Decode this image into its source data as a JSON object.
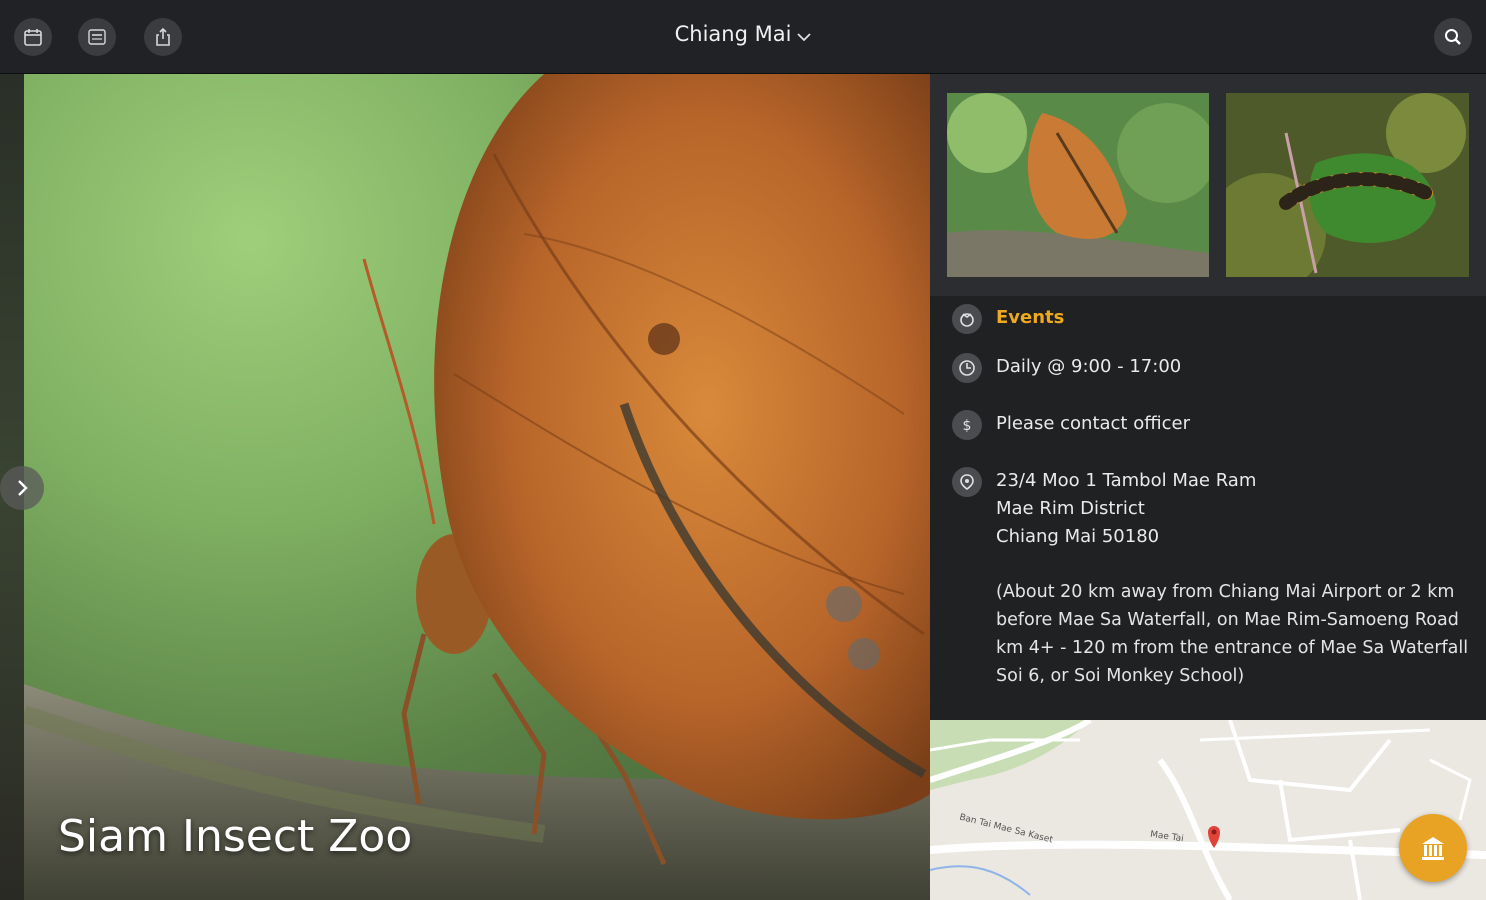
{
  "header": {
    "city": "Chiang Mai",
    "icons": [
      "calendar-icon",
      "dictionary-icon",
      "share-icon",
      "search-icon"
    ]
  },
  "place": {
    "title": "Siam Insect Zoo",
    "category": "Events",
    "hours": "Daily @ 9:00 - 17:00",
    "price": "Please contact officer",
    "address_line1": "23/4 Moo 1 Tambol Mae Ram",
    "address_line2": "Mae Rim District",
    "address_line3": "Chiang Mai 50180",
    "directions": "(About 20 km away from Chiang Mai Airport or 2 km before Mae Sa Waterfall, on Mae Rim-Samoeng Road km 4+ - 120 m from the entrance of Mae Sa Waterfall Soi 6, or Soi Monkey School)"
  },
  "map": {
    "road_label_1": "Ban Tai Mae Sa Kaset",
    "road_label_2": "Mae Tai",
    "pin_color": "#e0433a"
  },
  "colors": {
    "accent": "#f0a81e",
    "fab": "#e8a325",
    "panel_bg": "#1f2123",
    "topbar_bg": "#202225"
  }
}
